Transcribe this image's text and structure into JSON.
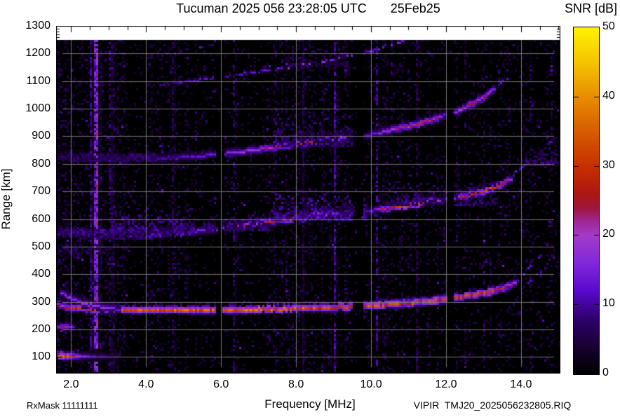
{
  "title": {
    "main": "Tucuman 2025 056 23:28:05 UTC",
    "date": "25Feb25"
  },
  "colorbar": {
    "label": "SNR [dB]",
    "min": 0,
    "max": 50,
    "tick_values": [
      0,
      10,
      20,
      30,
      40,
      50
    ],
    "tick_labels": [
      "0",
      "10",
      "20",
      "30",
      "40",
      "50"
    ]
  },
  "axes": {
    "x_label": "Frequency [MHz]",
    "y_label": "Range [km]",
    "x_tick_values": [
      2,
      4,
      6,
      8,
      10,
      12,
      14
    ],
    "x_tick_labels": [
      "2.0",
      "4.0",
      "6.0",
      "8.0",
      "10.0",
      "12.0",
      "14.0"
    ],
    "y_tick_values": [
      100,
      200,
      300,
      400,
      500,
      600,
      700,
      800,
      900,
      1000,
      1100,
      1200,
      1300
    ],
    "y_tick_labels": [
      "100",
      "200",
      "300",
      "400",
      "500",
      "600",
      "700",
      "800",
      "900",
      "1000",
      "1100",
      "1200",
      "1300"
    ]
  },
  "footer": {
    "left": "RxMask 11111111",
    "right": "VIPIR  TMJ20_2025056232805.RIQ"
  },
  "chart_data": {
    "type": "heatmap",
    "title": "Tucuman 2025 056 23:28:05 UTC 25Feb25",
    "xlabel": "Frequency [MHz]",
    "ylabel": "Range [km]",
    "zlabel": "SNR [dB]",
    "x_min": 1.6,
    "x_max": 15.05,
    "y_min": 40,
    "y_max": 1300,
    "data_y_max": 1250,
    "z_min": 0,
    "z_max": 50,
    "grid": true,
    "background_color": "#000000",
    "grid_color": "#808080",
    "colormap": [
      [
        0,
        0,
        0,
        0
      ],
      [
        4,
        26,
        0,
        51
      ],
      [
        8,
        48,
        0,
        110
      ],
      [
        12,
        90,
        10,
        205
      ],
      [
        16,
        130,
        40,
        220
      ],
      [
        20,
        165,
        60,
        200
      ],
      [
        22,
        158,
        40,
        150
      ],
      [
        24,
        160,
        22,
        60
      ],
      [
        26,
        172,
        24,
        18
      ],
      [
        30,
        200,
        48,
        0
      ],
      [
        35,
        216,
        92,
        0
      ],
      [
        40,
        232,
        142,
        0
      ],
      [
        45,
        246,
        196,
        0
      ],
      [
        50,
        255,
        243,
        0
      ]
    ],
    "noise": {
      "seed": 2025056,
      "cell": 3,
      "base_p": 0.2,
      "hot_low_f_max": 3.35,
      "hot_band": [
        7.4,
        9.6
      ]
    },
    "rfi_lines": [
      {
        "f": 2.62,
        "s": 15,
        "p": 0.9
      },
      {
        "f": 2.72,
        "s": 19,
        "p": 0.92
      },
      {
        "f": 2.5,
        "s": 9,
        "p": 0.7
      },
      {
        "f": 3.04,
        "s": 8,
        "p": 0.6
      },
      {
        "f": 4.7,
        "s": 7,
        "p": 0.45
      },
      {
        "f": 6.36,
        "s": 8,
        "p": 0.5
      },
      {
        "f": 9.02,
        "s": 11,
        "p": 0.75
      },
      {
        "f": 10.14,
        "s": 10,
        "p": 0.6
      },
      {
        "f": 11.24,
        "s": 7,
        "p": 0.5
      }
    ],
    "blackout_bands": [
      [
        5.9,
        6.05
      ],
      [
        9.54,
        9.77
      ],
      [
        12.03,
        12.21
      ]
    ],
    "traces": [
      {
        "name": "F2-O-1hop",
        "style": "solid",
        "jitter": 5,
        "points": [
          [
            1.6,
            295,
            22
          ],
          [
            1.9,
            281,
            25
          ],
          [
            2.3,
            275,
            29
          ],
          [
            3,
            271,
            31
          ],
          [
            4,
            269,
            33
          ],
          [
            5,
            269,
            34
          ],
          [
            6,
            270,
            33
          ],
          [
            7,
            272,
            35
          ],
          [
            8,
            275,
            33
          ],
          [
            9,
            279,
            31
          ],
          [
            10,
            285,
            33
          ],
          [
            10.8,
            293,
            30
          ],
          [
            11.6,
            303,
            31
          ],
          [
            12.3,
            315,
            29
          ],
          [
            12.9,
            327,
            29
          ],
          [
            13.3,
            339,
            30
          ],
          [
            13.6,
            352,
            25
          ],
          [
            13.85,
            368,
            17
          ]
        ]
      },
      {
        "name": "F2-O-1hop-tip",
        "style": "dots",
        "dot_p": 0.4,
        "jitter": 6,
        "points": [
          [
            13.9,
            378,
            13
          ],
          [
            14.05,
            395,
            13
          ],
          [
            14.2,
            416,
            12
          ],
          [
            14.35,
            440,
            12
          ],
          [
            14.5,
            465,
            11
          ],
          [
            14.62,
            488,
            11
          ],
          [
            14.72,
            508,
            10
          ]
        ]
      },
      {
        "name": "F2-X-1hop-left",
        "style": "solid",
        "jitter": 3,
        "points": [
          [
            1.75,
            332,
            15
          ],
          [
            2,
            312,
            17
          ],
          [
            2.3,
            296,
            19
          ],
          [
            2.6,
            285,
            19
          ],
          [
            2.95,
            277,
            17
          ],
          [
            3.3,
            273,
            12
          ]
        ]
      },
      {
        "name": "F2-X-1hop-right",
        "style": "dots",
        "dot_p": 0.42,
        "jitter": 6,
        "points": [
          [
            14,
            352,
            12
          ],
          [
            14.2,
            368,
            12
          ],
          [
            14.4,
            390,
            11
          ],
          [
            14.6,
            418,
            11
          ],
          [
            14.78,
            448,
            10
          ],
          [
            14.95,
            470,
            10
          ]
        ]
      },
      {
        "name": "2hop-flat",
        "style": "diffuse",
        "jitter": 8,
        "points": [
          [
            1.6,
            549,
            9
          ],
          [
            2.2,
            546,
            10
          ],
          [
            3,
            544,
            11
          ],
          [
            3.8,
            545,
            12
          ],
          [
            4.6,
            548,
            12
          ],
          [
            5.2,
            553,
            13
          ]
        ]
      },
      {
        "name": "2hop-rise",
        "style": "solid",
        "jitter": 4,
        "points": [
          [
            5.2,
            553,
            13
          ],
          [
            6,
            564,
            15
          ],
          [
            6.6,
            577,
            21
          ],
          [
            7.2,
            589,
            26
          ],
          [
            8,
            603,
            30
          ],
          [
            8.6,
            613,
            28
          ],
          [
            9,
            619,
            15
          ],
          [
            9.5,
            625,
            7
          ],
          [
            10,
            631,
            11
          ],
          [
            10.35,
            636,
            25
          ],
          [
            11,
            649,
            30
          ],
          [
            11.6,
            663,
            28
          ],
          [
            11.9,
            669,
            13
          ],
          [
            12.2,
            675,
            15
          ],
          [
            12.5,
            683,
            26
          ],
          [
            13,
            699,
            30
          ],
          [
            13.3,
            713,
            31
          ],
          [
            13.55,
            729,
            25
          ],
          [
            13.75,
            749,
            15
          ]
        ]
      },
      {
        "name": "2hop-tip",
        "style": "dots",
        "dot_p": 0.5,
        "jitter": 6,
        "points": [
          [
            13.8,
            758,
            13
          ],
          [
            13.95,
            778,
            11
          ],
          [
            14.1,
            800,
            10
          ]
        ]
      },
      {
        "name": "2hop-X-tip",
        "style": "dots",
        "dot_p": 0.45,
        "jitter": 7,
        "points": [
          [
            14.15,
            795,
            10
          ],
          [
            14.35,
            822,
            10
          ],
          [
            14.55,
            848,
            9
          ],
          [
            14.75,
            874,
            9
          ],
          [
            14.9,
            895,
            8
          ]
        ]
      },
      {
        "name": "3hop-flat",
        "style": "diffuse",
        "jitter": 8,
        "points": [
          [
            1.6,
            823,
            7
          ],
          [
            2.4,
            819,
            8
          ],
          [
            3.2,
            818,
            8
          ],
          [
            4.3,
            820,
            9
          ]
        ]
      },
      {
        "name": "3hop-rise",
        "style": "solid",
        "jitter": 4,
        "points": [
          [
            4.3,
            820,
            10
          ],
          [
            5.2,
            826,
            12
          ],
          [
            6,
            834,
            15
          ],
          [
            6.6,
            843,
            17
          ],
          [
            7.2,
            855,
            21
          ],
          [
            7.8,
            867,
            25
          ],
          [
            8.4,
            877,
            26
          ],
          [
            8.9,
            885,
            22
          ],
          [
            9.3,
            893,
            14
          ],
          [
            9.6,
            899,
            7
          ],
          [
            10.1,
            909,
            13
          ],
          [
            10.5,
            921,
            20
          ],
          [
            11,
            935,
            23
          ],
          [
            11.5,
            953,
            25
          ],
          [
            11.8,
            967,
            21
          ],
          [
            12,
            976,
            10
          ],
          [
            12.25,
            986,
            16
          ],
          [
            12.6,
            1009,
            23
          ],
          [
            12.9,
            1031,
            25
          ],
          [
            13.1,
            1049,
            21
          ],
          [
            13.3,
            1069,
            15
          ]
        ]
      },
      {
        "name": "3hop-tip",
        "style": "dots",
        "dot_p": 0.5,
        "jitter": 6,
        "points": [
          [
            13.35,
            1075,
            12
          ],
          [
            13.5,
            1092,
            11
          ],
          [
            13.65,
            1115,
            10
          ]
        ]
      },
      {
        "name": "4hop",
        "style": "dots",
        "dot_p": 0.62,
        "jitter": 5,
        "points": [
          [
            4,
            1083,
            7
          ],
          [
            4.6,
            1090,
            8
          ],
          [
            5.2,
            1100,
            10
          ],
          [
            5.7,
            1110,
            12
          ],
          [
            6.1,
            1118,
            9
          ],
          [
            6.5,
            1124,
            11
          ],
          [
            7,
            1134,
            12
          ],
          [
            7.5,
            1144,
            14
          ],
          [
            8,
            1154,
            16
          ],
          [
            8.5,
            1166,
            17
          ],
          [
            9,
            1178,
            15
          ],
          [
            9.4,
            1190,
            13
          ],
          [
            9.8,
            1203,
            12
          ],
          [
            10.2,
            1218,
            13
          ],
          [
            10.6,
            1234,
            13
          ],
          [
            10.9,
            1247,
            12
          ]
        ]
      },
      {
        "name": "E-echo",
        "style": "solid",
        "jitter": 2,
        "points": [
          [
            1.6,
            107,
            29
          ],
          [
            1.8,
            105,
            33
          ],
          [
            2,
            104,
            31
          ],
          [
            2.2,
            104,
            20
          ],
          [
            2.5,
            104,
            11
          ],
          [
            2.9,
            105,
            8
          ],
          [
            3.3,
            106,
            6
          ]
        ]
      },
      {
        "name": "E-echo-2hop",
        "style": "solid",
        "jitter": 2,
        "points": [
          [
            1.6,
            209,
            16
          ],
          [
            1.75,
            206,
            22
          ],
          [
            1.95,
            206,
            19
          ],
          [
            2.1,
            207,
            9
          ]
        ]
      }
    ],
    "diffuse_clouds": [
      {
        "f0": 3.05,
        "f1": 5.3,
        "r0": 548,
        "r1": 645,
        "n": 420,
        "s": 10
      },
      {
        "f0": 5.5,
        "f1": 7.3,
        "r0": 560,
        "r1": 628,
        "n": 260,
        "s": 9
      },
      {
        "f0": 7.35,
        "f1": 9.9,
        "r0": 598,
        "r1": 715,
        "n": 520,
        "s": 11
      },
      {
        "f0": 10.4,
        "f1": 13.4,
        "r0": 650,
        "r1": 760,
        "n": 300,
        "s": 9
      },
      {
        "f0": 7.4,
        "f1": 9.7,
        "r0": 862,
        "r1": 990,
        "n": 330,
        "s": 9
      },
      {
        "f0": 7.7,
        "f1": 9.4,
        "r0": 1150,
        "r1": 1232,
        "n": 130,
        "s": 8
      },
      {
        "f0": 14.15,
        "f1": 15,
        "r0": 795,
        "r1": 882,
        "n": 120,
        "s": 9
      },
      {
        "f0": 1.6,
        "f1": 3,
        "r0": 470,
        "r1": 545,
        "n": 140,
        "s": 7
      },
      {
        "f0": 2.2,
        "f1": 4.2,
        "r0": 528,
        "r1": 560,
        "n": 160,
        "s": 9
      }
    ]
  }
}
